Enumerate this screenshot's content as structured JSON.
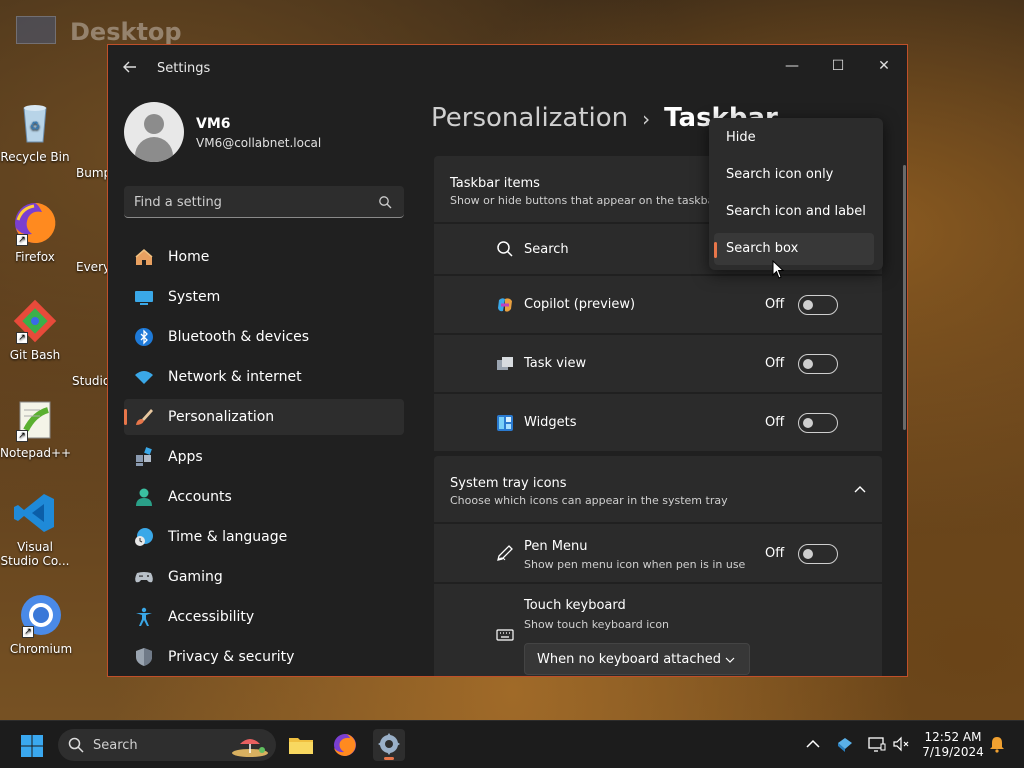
{
  "desktop": {
    "label": "Desktop",
    "icons": [
      {
        "name": "recycle-bin",
        "label": "Recycle Bin"
      },
      {
        "name": "firefox",
        "label": "Firefox"
      },
      {
        "name": "git-bash",
        "label": "Git Bash"
      },
      {
        "name": "notepad-plus-plus",
        "label": "Notepad++"
      },
      {
        "name": "visual-studio-code",
        "label": "Visual Studio Co..."
      },
      {
        "name": "chromium",
        "label": "Chromium"
      }
    ],
    "partial_icons": [
      {
        "label": "Bump"
      },
      {
        "label": "Every"
      },
      {
        "label": "Studio"
      }
    ]
  },
  "window": {
    "title": "Settings",
    "controls": {
      "minimize": "—",
      "maximize": "☐",
      "close": "✕"
    }
  },
  "profile": {
    "name": "VM6",
    "email": "VM6@collabnet.local"
  },
  "search": {
    "placeholder": "Find a setting"
  },
  "nav": [
    {
      "label": "Home",
      "icon": "home-icon",
      "active": false
    },
    {
      "label": "System",
      "icon": "system-icon",
      "active": false
    },
    {
      "label": "Bluetooth & devices",
      "icon": "bluetooth-icon",
      "active": false
    },
    {
      "label": "Network & internet",
      "icon": "wifi-icon",
      "active": false
    },
    {
      "label": "Personalization",
      "icon": "brush-icon",
      "active": true
    },
    {
      "label": "Apps",
      "icon": "apps-icon",
      "active": false
    },
    {
      "label": "Accounts",
      "icon": "account-icon",
      "active": false
    },
    {
      "label": "Time & language",
      "icon": "clock-globe-icon",
      "active": false
    },
    {
      "label": "Gaming",
      "icon": "gamepad-icon",
      "active": false
    },
    {
      "label": "Accessibility",
      "icon": "accessibility-icon",
      "active": false
    },
    {
      "label": "Privacy & security",
      "icon": "shield-icon",
      "active": false
    }
  ],
  "breadcrumb": {
    "parent": "Personalization",
    "separator": "›",
    "current": "Taskbar"
  },
  "taskbar_items": {
    "title": "Taskbar items",
    "subtitle": "Show or hide buttons that appear on the taskbar",
    "rows": [
      {
        "label": "Search",
        "icon": "search-icon"
      },
      {
        "label": "Copilot (preview)",
        "icon": "copilot-icon",
        "state": "Off"
      },
      {
        "label": "Task view",
        "icon": "task-view-icon",
        "state": "Off"
      },
      {
        "label": "Widgets",
        "icon": "widgets-icon",
        "state": "Off"
      }
    ]
  },
  "system_tray": {
    "title": "System tray icons",
    "subtitle": "Choose which icons can appear in the system tray",
    "rows": [
      {
        "label": "Pen Menu",
        "sub": "Show pen menu icon when pen is in use",
        "icon": "pen-icon",
        "state": "Off"
      },
      {
        "label": "Touch keyboard",
        "sub": "Show touch keyboard icon",
        "icon": "keyboard-icon",
        "dropdown": "When no keyboard attached"
      }
    ]
  },
  "search_menu": {
    "options": [
      "Hide",
      "Search icon only",
      "Search icon and label",
      "Search box"
    ],
    "selected": "Search box"
  },
  "taskbar": {
    "search_label": "Search",
    "time": "12:52 AM",
    "date": "7/19/2024"
  },
  "colors": {
    "accent": "#e8764a",
    "window_bg": "#202020",
    "card_bg": "#2b2b2b"
  }
}
